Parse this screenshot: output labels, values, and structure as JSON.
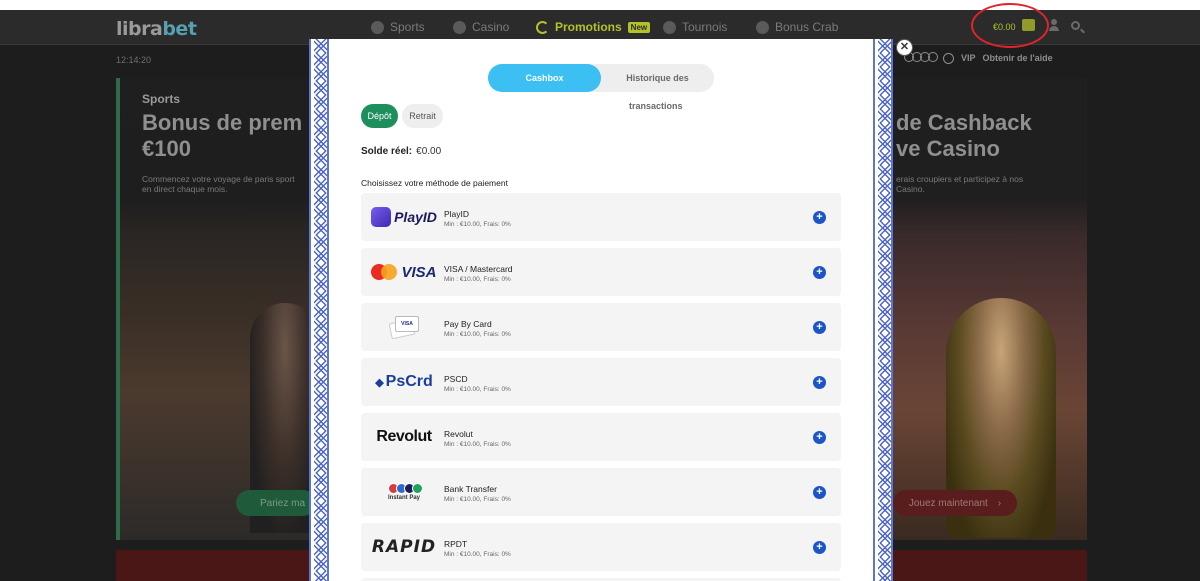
{
  "site": {
    "logo_part1": "libra",
    "logo_part2": "bet",
    "nav": [
      {
        "label": "Sports"
      },
      {
        "label": "Casino"
      },
      {
        "label": "Promotions",
        "badge": "New"
      },
      {
        "label": "Tournois"
      },
      {
        "label": "Bonus Crab"
      }
    ],
    "balance": "€0.00",
    "clock": "12:14:20",
    "subbar": {
      "vip": "VIP",
      "help": "Obtenir de l'aide"
    },
    "left_banner": {
      "kicker": "Sports",
      "headline_line1": "Bonus de prem",
      "headline_line2": "€100",
      "desc_line1": "Commencez votre voyage de paris sport",
      "desc_line2": "en direct chaque mois.",
      "cta": "Pariez ma"
    },
    "right_banner": {
      "headline_line1": "de Cashback",
      "headline_line2": "ve Casino",
      "desc_line1": "erais croupiers et participez à nos",
      "desc_line2": "Casino.",
      "cta": "Jouez maintenant",
      "cta_arrow": "›"
    }
  },
  "modal": {
    "close": "✕",
    "tabs": {
      "cashbox": "Cashbox",
      "history_line1": "Historique des",
      "history_line2": "transactions"
    },
    "actions": {
      "deposit": "Dépôt",
      "withdraw": "Retrait"
    },
    "balance_label": "Solde réel:",
    "balance_value": "€0.00",
    "choose_label": "Choisissez votre méthode de paiement",
    "methods": [
      {
        "name": "PlayID",
        "limits": "Min : €10.00, Frais: 0%",
        "logo_text": "PlayID"
      },
      {
        "name": "VISA / Mastercard",
        "limits": "Min : €10.00, Frais: 0%",
        "logo_text": "VISA"
      },
      {
        "name": "Pay By Card",
        "limits": "Min : €10.00, Frais: 0%",
        "logo_text": "VISA"
      },
      {
        "name": "PSCD",
        "limits": "Min : €10.00, Frais: 0%",
        "logo_text": "PsCrd"
      },
      {
        "name": "Revolut",
        "limits": "Min : €10.00, Frais: 0%",
        "logo_text": "Revolut"
      },
      {
        "name": "Bank Transfer",
        "limits": "Min : €10.00, Frais: 0%",
        "logo_text": "Instant Pay"
      },
      {
        "name": "RPDT",
        "limits": "Min : €10.00, Frais: 0%",
        "logo_text": "RAPID"
      }
    ],
    "add_symbol": "+"
  },
  "colors": {
    "accent_blue": "#3cbff2",
    "deposit_green": "#1e8f5c",
    "add_button_blue": "#1c55c9",
    "promo_yellow": "#b4c22a",
    "highlight_circle": "#e2232a",
    "border_pattern": "#4e67c6"
  },
  "icons": [
    "sports-icon",
    "casino-icon",
    "promotions-icon",
    "tournaments-icon",
    "bonus-crab-icon",
    "wallet-icon",
    "user-icon",
    "search-icon",
    "globe-icon",
    "close-icon",
    "add-icon"
  ]
}
